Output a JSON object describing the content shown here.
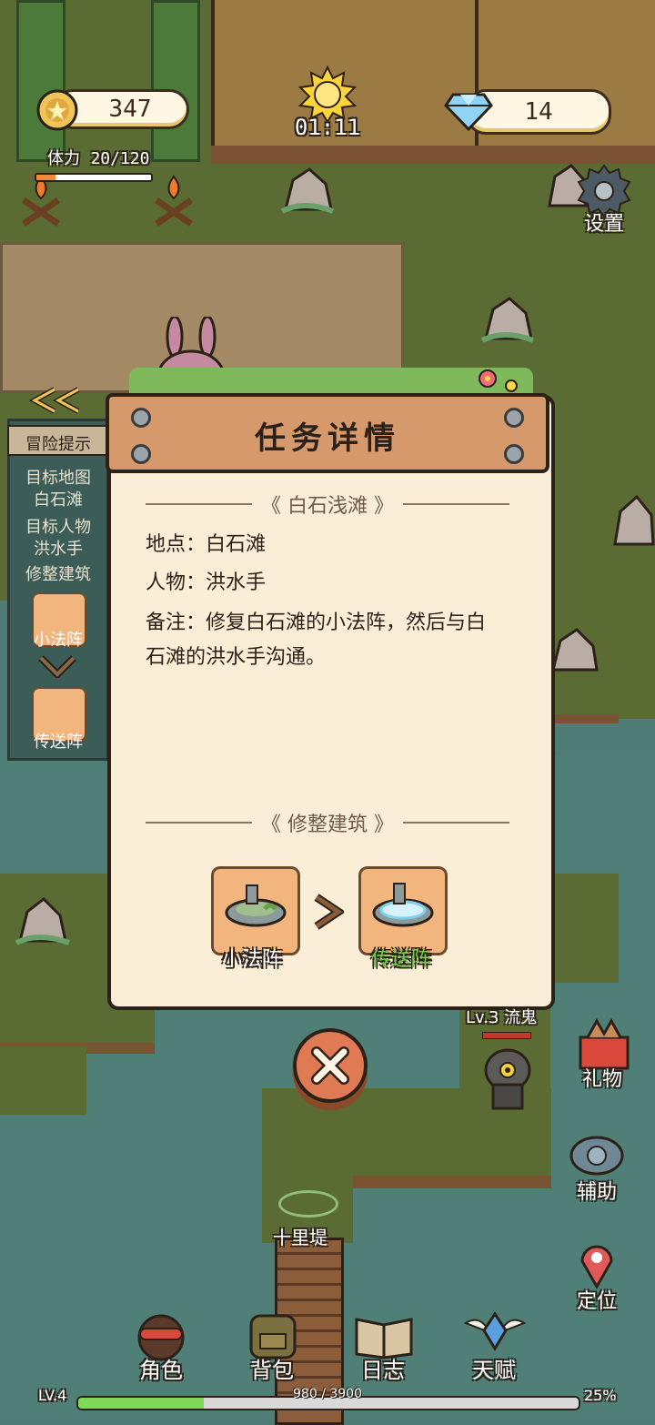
{
  "hud": {
    "coins": "347",
    "gems": "14",
    "time": "01:11",
    "stamina_label": "体力",
    "stamina_value": "20/120",
    "settings_label": "设置"
  },
  "hint_panel": {
    "title": "冒险提示",
    "target_map_label": "目标地图",
    "target_map_value": "白石滩",
    "target_npc_label": "目标人物",
    "target_npc_value": "洪水手",
    "repair_label": "修整建筑",
    "item1": "小法阵",
    "item2": "传送阵"
  },
  "dialog": {
    "title": "任务详情",
    "section1": "白石浅滩",
    "location_label": "地点：",
    "location_value": "白石滩",
    "npc_label": "人物：",
    "npc_value": "洪水手",
    "note_label": "备注：",
    "note_line1": "修复白石滩的小法阵，然后与白",
    "note_line2": "石滩的洪水手沟通。",
    "section2": "修整建筑",
    "from_item": "小法阵",
    "to_item": "传送阵"
  },
  "map": {
    "enemy_label": "Lv.3 流鬼",
    "place_label": "十里堤"
  },
  "right_menu": {
    "gift": "礼物",
    "assist": "辅助",
    "locate": "定位"
  },
  "bottom_nav": {
    "character": "角色",
    "bag": "背包",
    "journal": "日志",
    "talent": "天赋"
  },
  "xp": {
    "level": "LV.4",
    "progress": "980 / 3900",
    "percent": "25%",
    "fraction": 0.25
  },
  "colors": {
    "panel": "#fbeed6",
    "plank": "#d6996b",
    "accent_green": "#6fcf3f",
    "close": "#e07a55"
  }
}
